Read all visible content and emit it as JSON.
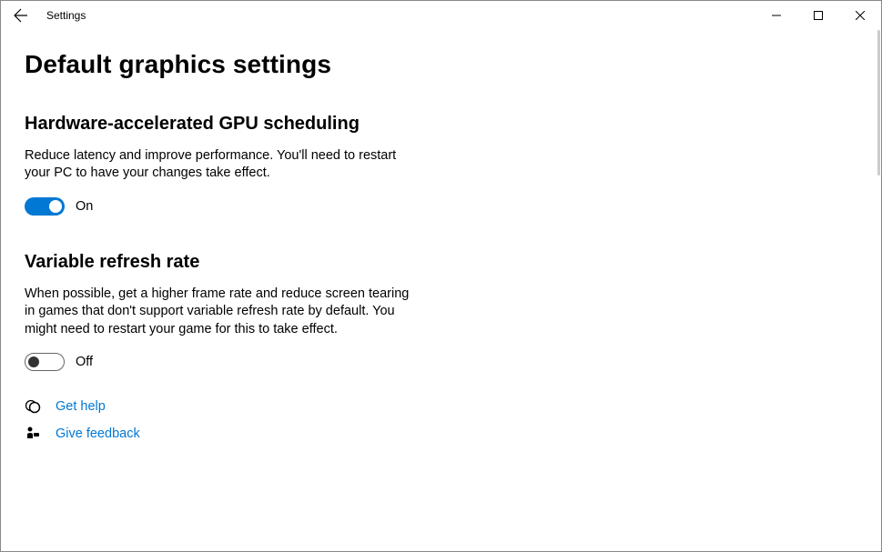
{
  "titlebar": {
    "app_title": "Settings"
  },
  "page": {
    "title": "Default graphics settings"
  },
  "sections": {
    "gpu_scheduling": {
      "title": "Hardware-accelerated GPU scheduling",
      "description": "Reduce latency and improve performance. You'll need to restart your PC to have your changes take effect.",
      "toggle_state": "on",
      "toggle_label": "On"
    },
    "variable_refresh": {
      "title": "Variable refresh rate",
      "description": "When possible, get a higher frame rate and reduce screen tearing in games that don't support variable refresh rate by default. You might need to restart your game for this to take effect.",
      "toggle_state": "off",
      "toggle_label": "Off"
    }
  },
  "links": {
    "help": "Get help",
    "feedback": "Give feedback"
  }
}
